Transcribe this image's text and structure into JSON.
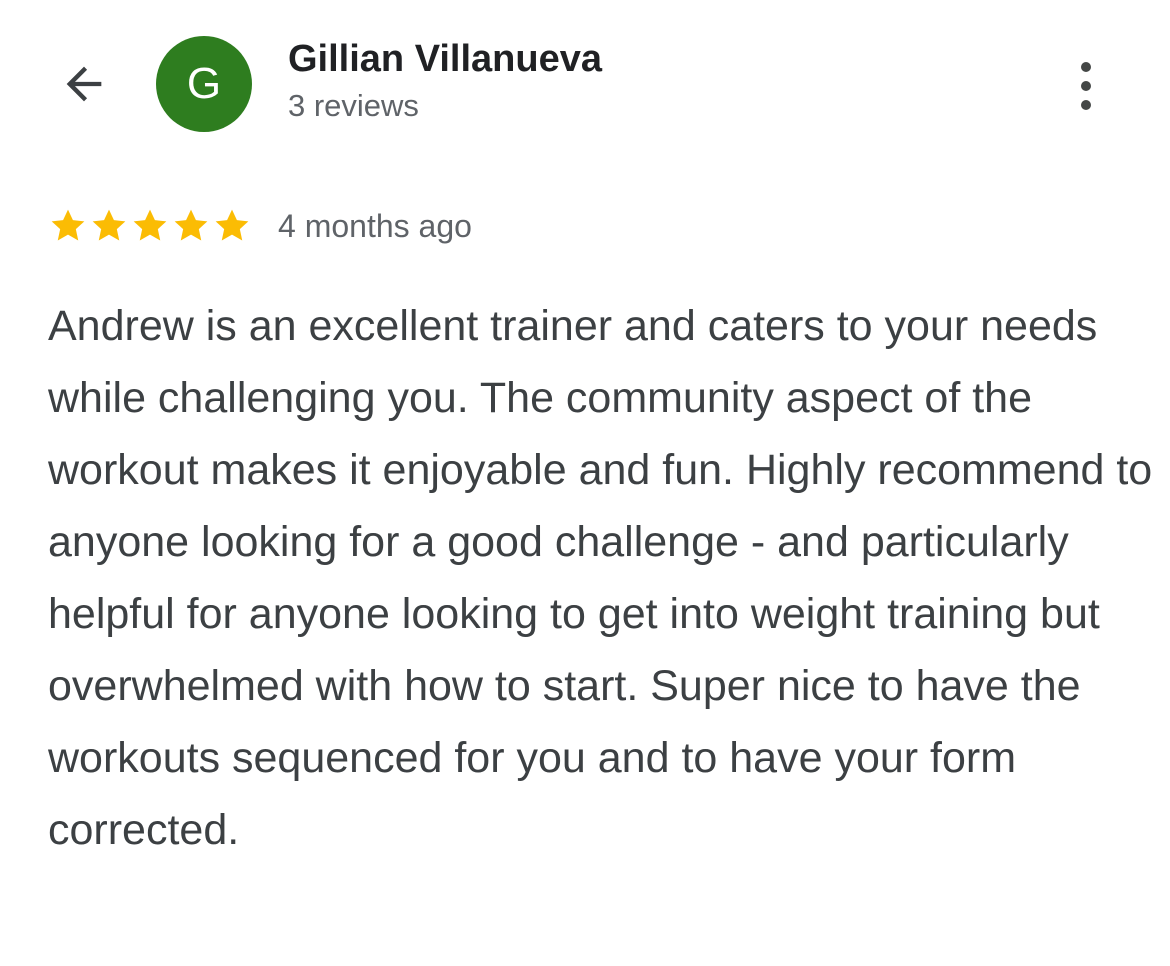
{
  "header": {
    "back_icon": "arrow-back-icon",
    "more_icon": "more-vert-icon"
  },
  "reviewer": {
    "initial": "G",
    "name": "Gillian Villanueva",
    "reviews_count": "3 reviews",
    "avatar_color": "#2e7d1f"
  },
  "review": {
    "rating": 5,
    "max_rating": 5,
    "star_color": "#fbbc04",
    "star_icon": "star-icon",
    "date": "4 months ago",
    "text": "Andrew is an excellent trainer and caters to your needs while challenging you. The community aspect of the workout makes it enjoyable and fun. Highly recommend to anyone looking for a good challenge - and particularly helpful for anyone looking to get into weight training but overwhelmed with how to start. Super nice to have the workouts sequenced for you and to have your form corrected."
  }
}
